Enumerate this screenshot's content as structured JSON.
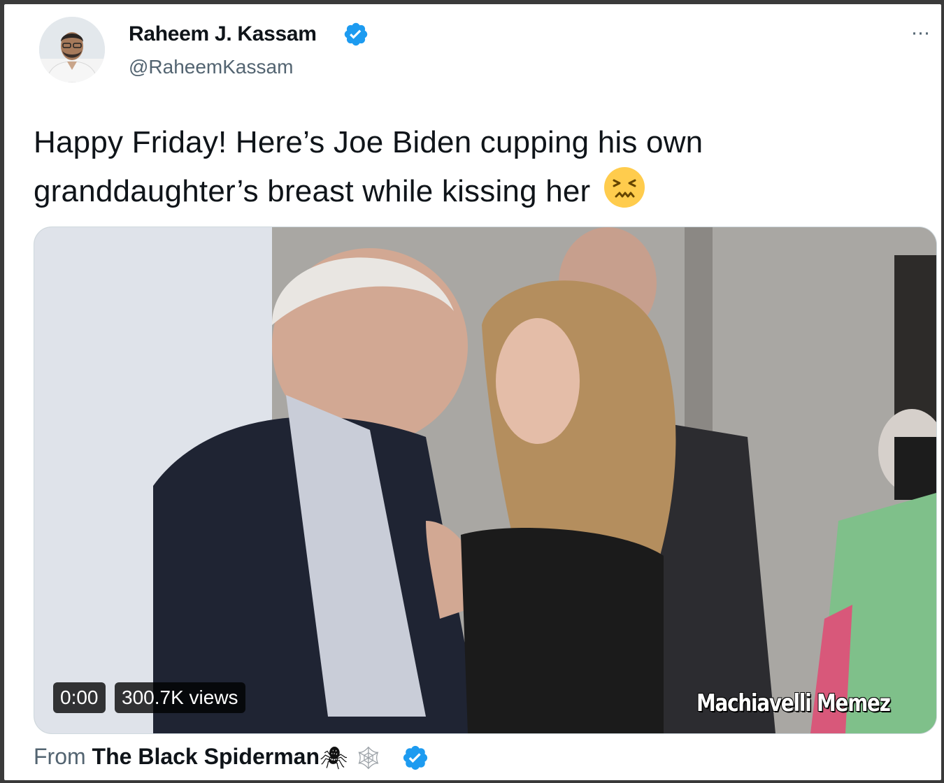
{
  "author": {
    "display_name": "Raheem J. Kassam",
    "handle": "@RaheemKassam",
    "verified": true,
    "avatar_icon": "profile-photo"
  },
  "more_label": "···",
  "tweet": {
    "text": "Happy Friday! Here’s Joe Biden cupping his own granddaughter’s breast while kissing her",
    "emoji": "confounded-face-emoji"
  },
  "video": {
    "time": "0:00",
    "views": "300.7K views",
    "watermark": "Machiavelli Memez"
  },
  "attribution": {
    "prefix": "From",
    "source_name": "The Black Spiderman",
    "spider_glyph": "🕷",
    "web_glyph": "🕸",
    "verified": true
  },
  "colors": {
    "verified_blue": "#1d9bf0",
    "text_primary": "#0f1419",
    "text_secondary": "#536471"
  }
}
